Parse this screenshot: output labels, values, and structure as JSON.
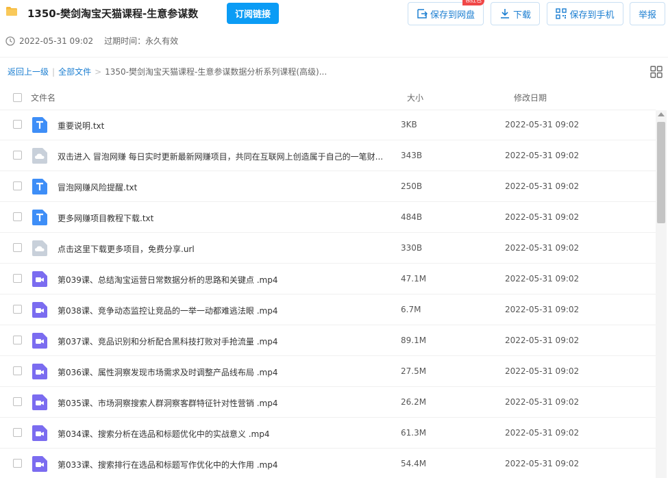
{
  "header": {
    "title": "1350-樊剑淘宝天猫课程-生意参谋数...",
    "subscribe_label": "订阅链接",
    "save_label": "保存到网盘",
    "hongbao_label": "领红包",
    "download_label": "下载",
    "phone_label": "保存到手机",
    "report_label": "举报",
    "date": "2022-05-31 09:02",
    "expire_label": "过期时间：永久有效"
  },
  "breadcrumb": {
    "back": "返回上一级",
    "sep1": "|",
    "all": "全部文件",
    "sep2": ">",
    "current": "1350-樊剑淘宝天猫课程-生意参谋数据分析系列课程(高级)..."
  },
  "table": {
    "col_name": "文件名",
    "col_size": "大小",
    "col_date": "修改日期",
    "rows": [
      {
        "name": "重要说明.txt",
        "size": "3KB",
        "date": "2022-05-31 09:02",
        "icon": "text-file-icon"
      },
      {
        "name": "双击进入 冒泡网赚 每日实时更新最新网赚项目，共同在互联网上创造属于自己的一笔财...",
        "size": "343B",
        "date": "2022-05-31 09:02",
        "icon": "link-file-icon"
      },
      {
        "name": "冒泡网赚风险提醒.txt",
        "size": "250B",
        "date": "2022-05-31 09:02",
        "icon": "text-file-icon"
      },
      {
        "name": "更多网赚项目教程下载.txt",
        "size": "484B",
        "date": "2022-05-31 09:02",
        "icon": "text-file-icon"
      },
      {
        "name": "点击这里下载更多项目，免费分享.url",
        "size": "330B",
        "date": "2022-05-31 09:02",
        "icon": "link-file-icon"
      },
      {
        "name": "第039课、总结淘宝运营日常数据分析的思路和关键点 .mp4",
        "size": "47.1M",
        "date": "2022-05-31 09:02",
        "icon": "video-file-icon"
      },
      {
        "name": "第038课、竞争动态监控让竞品的一举一动都难逃法眼 .mp4",
        "size": "6.7M",
        "date": "2022-05-31 09:02",
        "icon": "video-file-icon"
      },
      {
        "name": "第037课、竞品识别和分析配合黑科技打败对手抢流量 .mp4",
        "size": "89.1M",
        "date": "2022-05-31 09:02",
        "icon": "video-file-icon"
      },
      {
        "name": "第036课、属性洞察发现市场需求及时调整产品线布局 .mp4",
        "size": "27.5M",
        "date": "2022-05-31 09:02",
        "icon": "video-file-icon"
      },
      {
        "name": "第035课、市场洞察搜索人群洞察客群特征针对性营销 .mp4",
        "size": "26.2M",
        "date": "2022-05-31 09:02",
        "icon": "video-file-icon"
      },
      {
        "name": "第034课、搜索分析在选品和标题优化中的实战意义 .mp4",
        "size": "61.3M",
        "date": "2022-05-31 09:02",
        "icon": "video-file-icon"
      },
      {
        "name": "第033课、搜索排行在选品和标题写作优化中的大作用 .mp4",
        "size": "54.4M",
        "date": "2022-05-31 09:02",
        "icon": "video-file-icon"
      }
    ]
  },
  "colors": {
    "accent": "#0b9cf5",
    "link": "#1b7ed1",
    "text_icon": "#3e8ef7",
    "video_icon": "#7b6cf0",
    "link_icon": "#c8d0da",
    "badge": "#f04747"
  }
}
